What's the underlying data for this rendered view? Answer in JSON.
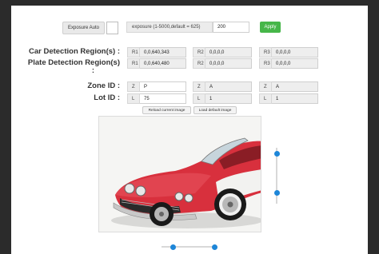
{
  "exposure": {
    "auto_label": "Exposure Auto",
    "label": "exposure (1-5000,default = 625)",
    "value": "200",
    "apply_label": "Apply"
  },
  "car_detection": {
    "label": "Car Detection Region(s) :",
    "regions": [
      {
        "tag": "R1",
        "value": "0,0,640,343"
      },
      {
        "tag": "R2",
        "value": "0,0,0,0"
      },
      {
        "tag": "R3",
        "value": "0,0,0,0"
      }
    ]
  },
  "plate_detection": {
    "label": "Plate Detection Region(s)",
    "label_cont": ":",
    "regions": [
      {
        "tag": "R1",
        "value": "0,0,640,480"
      },
      {
        "tag": "R2",
        "value": "0,0,0,0"
      },
      {
        "tag": "R3",
        "value": "0,0,0,0"
      }
    ]
  },
  "zone_id": {
    "label": "Zone ID :",
    "fields": [
      {
        "tag": "Z",
        "value": "P"
      },
      {
        "tag": "Z",
        "value": "A"
      },
      {
        "tag": "Z",
        "value": "A"
      }
    ]
  },
  "lot_id": {
    "label": "Lot ID :",
    "fields": [
      {
        "tag": "L",
        "value": "75"
      },
      {
        "tag": "L",
        "value": "1"
      },
      {
        "tag": "L",
        "value": "1"
      }
    ]
  },
  "buttons": {
    "reload": "Reload current image",
    "load_default": "Load default image"
  },
  "sliders": {
    "vertical": {
      "upper": 0.1,
      "lower": 0.8
    },
    "horizontal": {
      "left": 0.2,
      "right": 0.95
    }
  },
  "colors": {
    "accent": "#1d86d8",
    "apply": "#46b649"
  },
  "image": {
    "subject": "red vintage convertible sports car"
  }
}
